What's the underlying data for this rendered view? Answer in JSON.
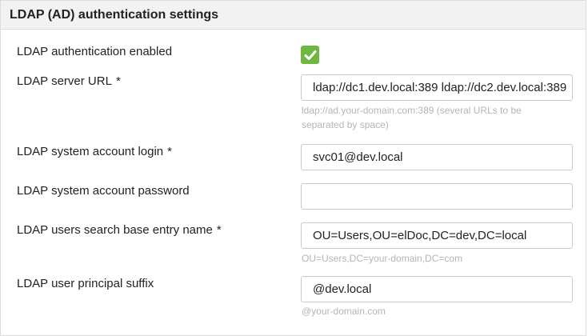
{
  "panel": {
    "title": "LDAP (AD) authentication settings"
  },
  "fields": {
    "enabled": {
      "label": "LDAP authentication enabled",
      "checked": true
    },
    "server_url": {
      "label": "LDAP server URL",
      "required_mark": "*",
      "value": "ldap://dc1.dev.local:389 ldap://dc2.dev.local:389",
      "hint": "ldap://ad.your-domain.com:389 (several URLs to be separated by space)"
    },
    "system_login": {
      "label": "LDAP system account login",
      "required_mark": "*",
      "value": "svc01@dev.local"
    },
    "system_password": {
      "label": "LDAP system account password",
      "value": ""
    },
    "search_base": {
      "label": "LDAP users search base entry name",
      "required_mark": "*",
      "value": "OU=Users,OU=elDoc,DC=dev,DC=local",
      "hint": "OU=Users,DC=your-domain,DC=com"
    },
    "upn_suffix": {
      "label": "LDAP user principal suffix",
      "value": "@dev.local",
      "hint": "@your-domain.com"
    }
  },
  "colors": {
    "checkbox_accent": "#6fb840",
    "hint_text": "#b5b5b5",
    "header_bg": "#f2f2f2"
  },
  "icons": {
    "checkbox": "checkmark-icon"
  }
}
